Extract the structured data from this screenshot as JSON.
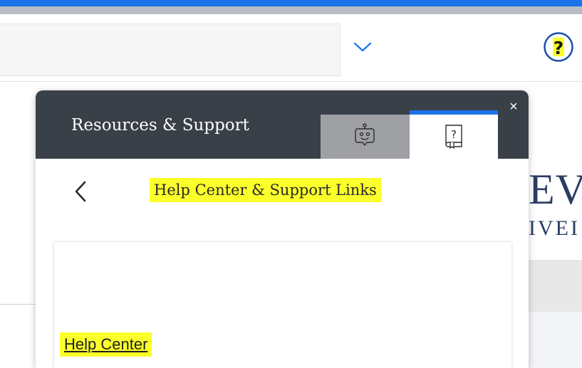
{
  "header": {
    "search_value": "",
    "dropdown_icon": "chevron-down-icon",
    "help_icon": "help-question-icon",
    "help_icon_symbol": "?"
  },
  "background": {
    "logo_line1": "EVI",
    "logo_line2": "IVEI"
  },
  "panel": {
    "title": "Resources & Support",
    "close_symbol": "×",
    "tabs": [
      {
        "icon": "chatbot-icon",
        "selected": false
      },
      {
        "icon": "help-guide-icon",
        "selected": true
      }
    ],
    "back_icon": "chevron-left-icon",
    "section_title": "Help Center & Support Links",
    "links": [
      {
        "label": "Help Center"
      }
    ]
  },
  "colors": {
    "accent_blue": "#1a73e8",
    "panel_header": "#3a4047",
    "highlight_yellow": "#fbff2a",
    "inactive_tab": "#9ea0a3",
    "logo_navy": "#2a3d63"
  }
}
